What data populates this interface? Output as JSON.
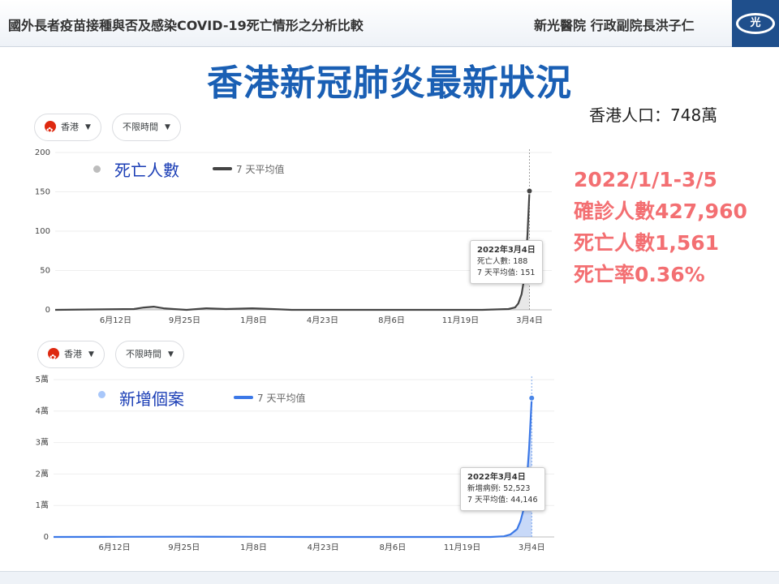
{
  "header": {
    "title": "國外長者疫苗接種與否及感染COVID-19死亡情形之分析比較",
    "author": "新光醫院 行政副院長洪子仁",
    "logo_char": "光"
  },
  "main_title": "香港新冠肺炎最新狀況",
  "population": "香港人口：748萬",
  "stats": [
    "2022/1/1-3/5",
    "確診人數427,960",
    "死亡人數1,561",
    "死亡率0.36%"
  ],
  "colors": {
    "deaths": "#444444",
    "cases": "#3b78e7",
    "title": "#1a5fb4",
    "stats": "#f36f72"
  },
  "chart_data": [
    {
      "type": "line",
      "region_chip": "香港",
      "time_chip": "不限時間",
      "series_legend": "死亡人數",
      "avg_legend": "7 天平均值",
      "x_labels": [
        "6月12日",
        "9月25日",
        "1月8日",
        "4月23日",
        "8月6日",
        "11月19日",
        "3月4日"
      ],
      "y_ticks": [
        "0",
        "50",
        "100",
        "150",
        "200"
      ],
      "ylim": [
        0,
        200
      ],
      "x_total": 756,
      "x_label_days": [
        92,
        197,
        302,
        407,
        512,
        617,
        722
      ],
      "series": [
        {
          "name": "7 天平均值",
          "points": [
            [
              0,
              0
            ],
            [
              120,
              1
            ],
            [
              135,
              3
            ],
            [
              150,
              4
            ],
            [
              165,
              2
            ],
            [
              180,
              1
            ],
            [
              200,
              0
            ],
            [
              230,
              2
            ],
            [
              260,
              1
            ],
            [
              300,
              2
            ],
            [
              330,
              1
            ],
            [
              360,
              0
            ],
            [
              400,
              0
            ],
            [
              500,
              0
            ],
            [
              600,
              0
            ],
            [
              650,
              0
            ],
            [
              690,
              1
            ],
            [
              700,
              3
            ],
            [
              705,
              8
            ],
            [
              710,
              20
            ],
            [
              715,
              45
            ],
            [
              719,
              95
            ],
            [
              722,
              151
            ]
          ]
        }
      ],
      "tooltip": {
        "date": "2022年3月4日",
        "series": "死亡人數: 188",
        "avg": "7 天平均值: 151"
      },
      "highlight": {
        "day": 722,
        "value": 151
      }
    },
    {
      "type": "line",
      "region_chip": "香港",
      "time_chip": "不限時間",
      "series_legend": "新增個案",
      "avg_legend": "7 天平均值",
      "x_labels": [
        "6月12日",
        "9月25日",
        "1月8日",
        "4月23日",
        "8月6日",
        "11月19日",
        "3月4日"
      ],
      "y_ticks": [
        "0",
        "1萬",
        "2萬",
        "3萬",
        "4萬",
        "5萬"
      ],
      "ylim": [
        0,
        50000
      ],
      "x_total": 756,
      "x_label_days": [
        92,
        197,
        302,
        407,
        512,
        617,
        722
      ],
      "series": [
        {
          "name": "7 天平均值",
          "points": [
            [
              0,
              0
            ],
            [
              100,
              50
            ],
            [
              200,
              80
            ],
            [
              300,
              60
            ],
            [
              400,
              10
            ],
            [
              500,
              5
            ],
            [
              600,
              5
            ],
            [
              660,
              10
            ],
            [
              680,
              200
            ],
            [
              690,
              800
            ],
            [
              700,
              2500
            ],
            [
              705,
              5000
            ],
            [
              710,
              9000
            ],
            [
              714,
              16000
            ],
            [
              718,
              28000
            ],
            [
              722,
              44146
            ]
          ]
        }
      ],
      "tooltip": {
        "date": "2022年3月4日",
        "series": "新增病例: 52,523",
        "avg": "7 天平均值: 44,146"
      },
      "highlight": {
        "day": 722,
        "value": 44146
      }
    }
  ]
}
